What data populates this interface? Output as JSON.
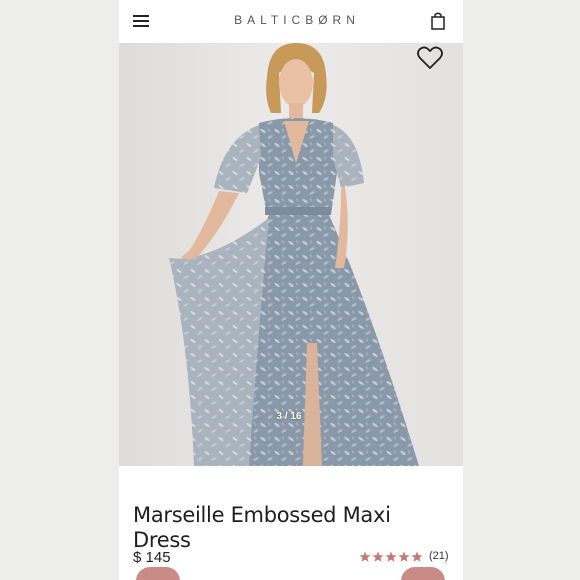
{
  "header": {
    "brand": "BALTICBØRN",
    "menu_icon": "hamburger-menu-icon",
    "bag_icon": "shopping-bag-icon"
  },
  "gallery": {
    "counter": "3 / 16",
    "wishlist_icon": "heart-outline-icon"
  },
  "product": {
    "title": "Marseille Embossed Maxi Dress",
    "price": "$ 145",
    "rating_stars": 5,
    "review_count": "(21)"
  },
  "colors": {
    "star": "#c07a73",
    "accent": "#c98b86",
    "dress": "#8b9aab"
  }
}
